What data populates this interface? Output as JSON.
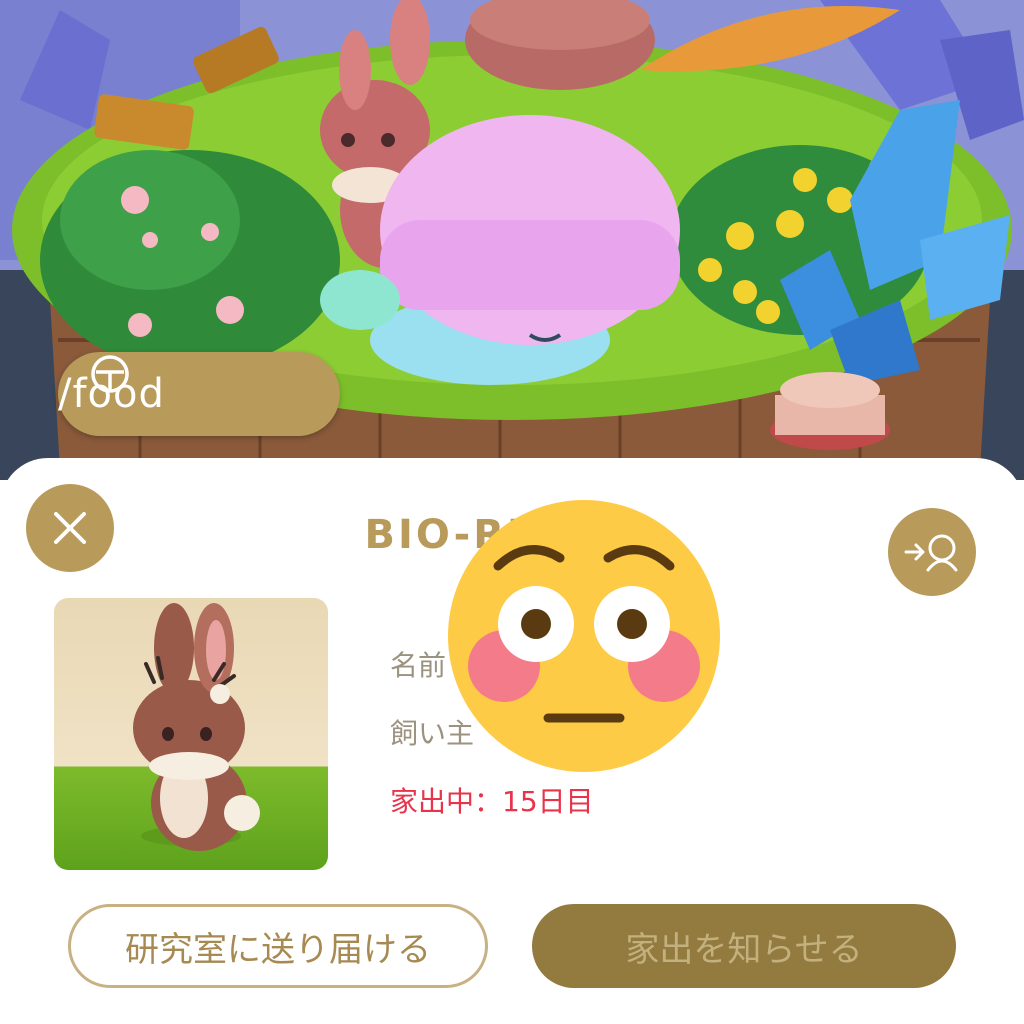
{
  "food_button": {
    "label": "/food",
    "icon": "cookie-icon"
  },
  "sheet": {
    "title": "BIO-RE　　D",
    "close_icon": "close-icon",
    "switch_icon": "switch-user-icon"
  },
  "pet_info": {
    "name_label": "名前",
    "owner_label": "飼い主",
    "away_status": "家出中：15日目"
  },
  "actions": {
    "deliver_label": "研究室に送り届ける",
    "notify_label": "家出を知らせる"
  },
  "colors": {
    "accent": "#b89a5a",
    "alert": "#e8344a",
    "solid_button": "#937a3e"
  },
  "overlay_emoji": "flushed-face-emoji"
}
